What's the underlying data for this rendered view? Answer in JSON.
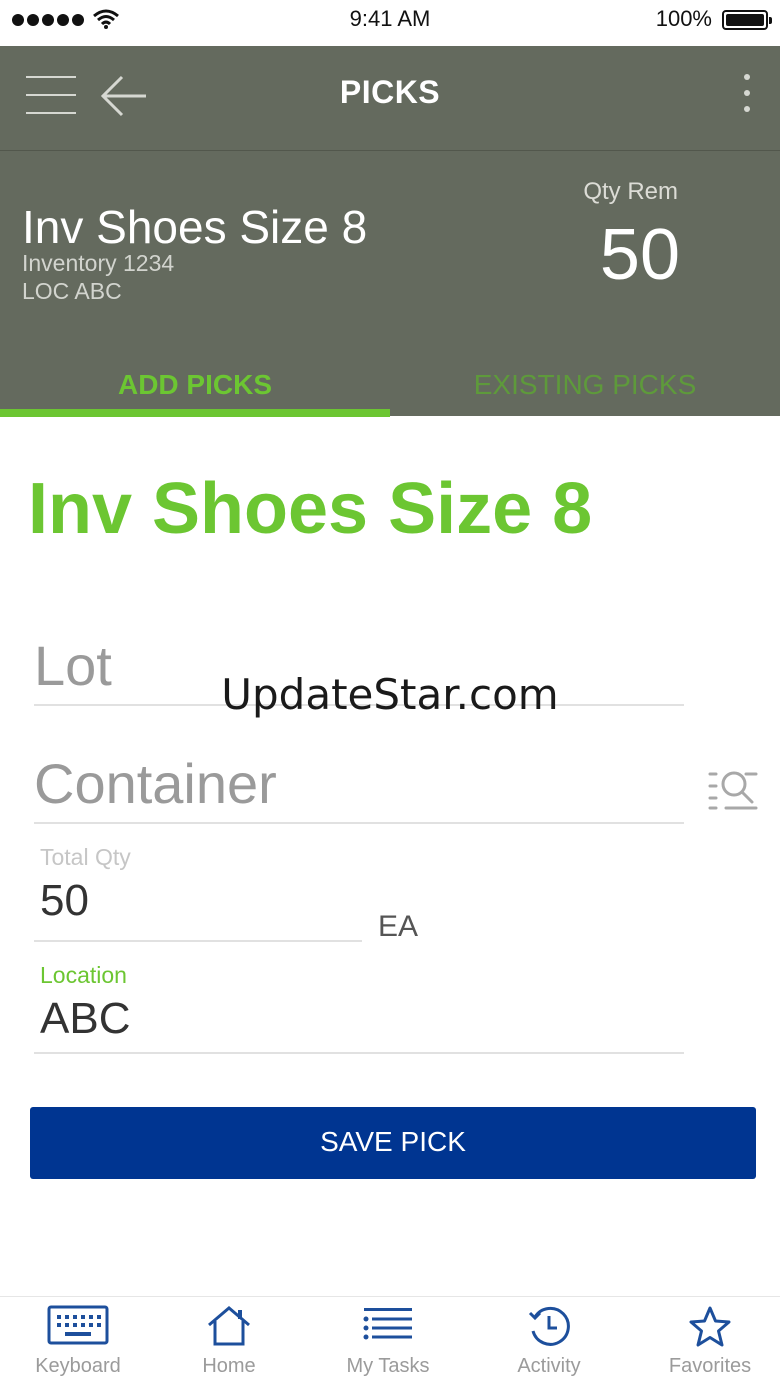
{
  "status_bar": {
    "time": "9:41 AM",
    "battery": "100%"
  },
  "header": {
    "title": "PICKS"
  },
  "item": {
    "name": "Inv Shoes Size 8",
    "inventory": "Inventory 1234",
    "location": "LOC ABC",
    "qty_label": "Qty Rem",
    "qty_value": "50"
  },
  "tabs": [
    {
      "label": "ADD PICKS",
      "active": true
    },
    {
      "label": "EXISTING PICKS",
      "active": false
    }
  ],
  "form": {
    "heading": "Inv Shoes Size 8",
    "lot_placeholder": "Lot",
    "container_placeholder": "Container",
    "total_qty_label": "Total Qty",
    "total_qty_value": "50",
    "unit": "EA",
    "location_label": "Location",
    "location_value": "ABC",
    "save_label": "SAVE PICK"
  },
  "watermark": "UpdateStar.com",
  "tabbar": [
    {
      "label": "Keyboard",
      "icon": "keyboard-icon"
    },
    {
      "label": "Home",
      "icon": "home-icon"
    },
    {
      "label": "My Tasks",
      "icon": "list-icon"
    },
    {
      "label": "Activity",
      "icon": "clock-icon"
    },
    {
      "label": "Favorites",
      "icon": "star-icon"
    }
  ],
  "colors": {
    "header_bg": "#646a5e",
    "accent_green": "#6cc632",
    "button_blue": "#003591",
    "tab_icon_blue": "#1d4f9c"
  }
}
